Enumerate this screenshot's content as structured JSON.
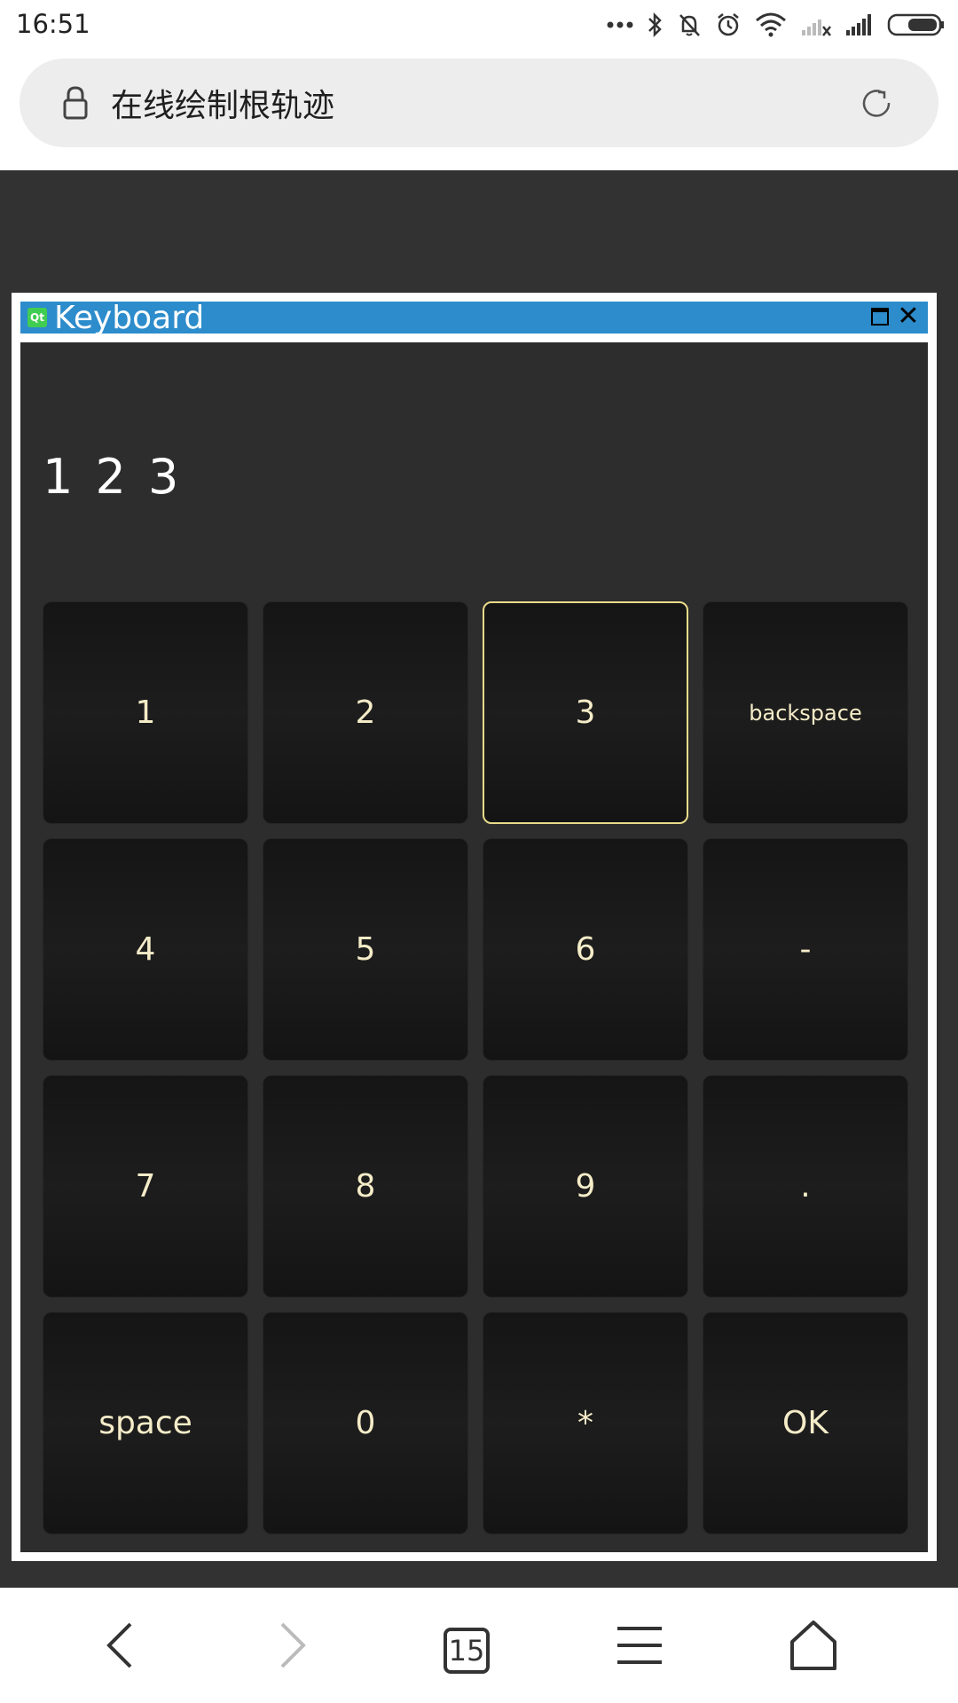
{
  "status_bar": {
    "time": "16:51"
  },
  "browser": {
    "address_text": "在线绘制根轨迹",
    "tab_count": "15"
  },
  "dialog": {
    "title": "Keyboard",
    "display_value": "1 2 3",
    "keys": [
      {
        "label": "1"
      },
      {
        "label": "2"
      },
      {
        "label": "3"
      },
      {
        "label": "backspace"
      },
      {
        "label": "4"
      },
      {
        "label": "5"
      },
      {
        "label": "6"
      },
      {
        "label": "-"
      },
      {
        "label": "7"
      },
      {
        "label": "8"
      },
      {
        "label": "9"
      },
      {
        "label": "."
      },
      {
        "label": "space"
      },
      {
        "label": "0"
      },
      {
        "label": "*"
      },
      {
        "label": "OK"
      }
    ],
    "focused_key": "3"
  },
  "colors": {
    "titlebar": "#2d8ccb",
    "dialog_body": "#2d2d2d",
    "key_text": "#f5ecc8",
    "focus_border": "#eadb8a"
  },
  "icons": [
    "more-dots-icon",
    "bluetooth-icon",
    "mute-bell-icon",
    "alarm-icon",
    "wifi-icon",
    "no-signal-icon",
    "signal-icon",
    "battery-icon",
    "lock-icon",
    "reload-icon",
    "back-icon",
    "forward-icon",
    "menu-icon",
    "home-icon",
    "qt-logo-icon",
    "maximize-icon",
    "close-icon"
  ]
}
